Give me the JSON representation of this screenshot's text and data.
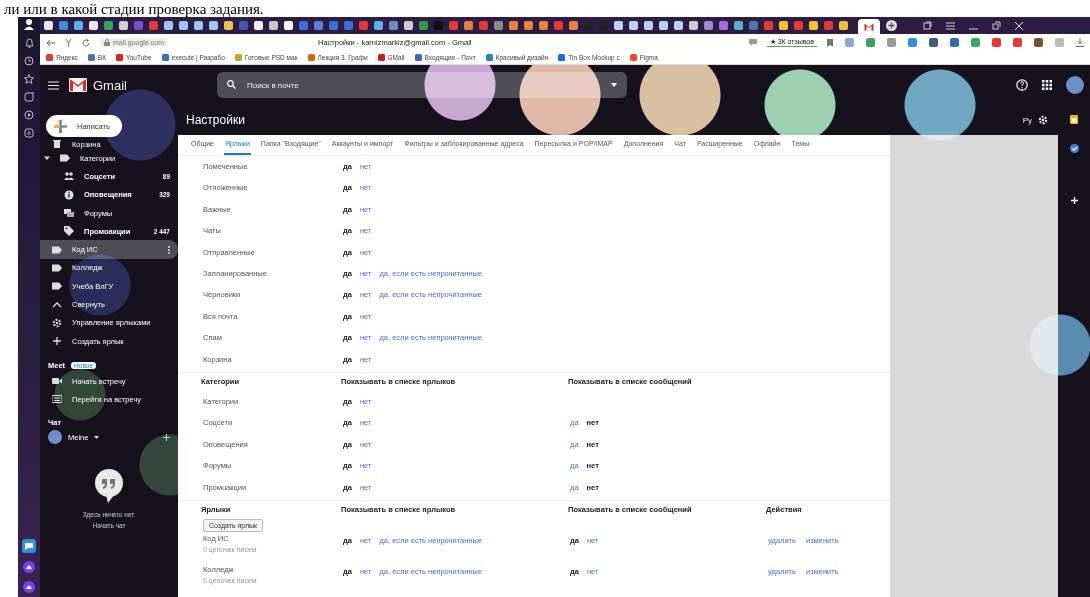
{
  "document_text": "ли или в какой стадии проверка задания.",
  "browser": {
    "address": "mail.google.com",
    "page_title": "Настройки - karnizmarkiz@gmail.com - Gmail",
    "reviews_badge": "★ 3К отзывов",
    "bookmarks": [
      {
        "label": "Яндекс",
        "color": "#e53935"
      },
      {
        "label": "ВК",
        "color": "#4a76a8"
      },
      {
        "label": "YouTube",
        "color": "#e62117"
      },
      {
        "label": "execute | Разрабо",
        "color": "#3d6fc4"
      },
      {
        "label": "Готовые PSD мак",
        "color": "#c9a227"
      },
      {
        "label": "Лекция 3. Графи",
        "color": "#d2691e"
      },
      {
        "label": "GMail",
        "color": "#c5221f"
      },
      {
        "label": "Входящие - Почт",
        "color": "#3367d6"
      },
      {
        "label": "Красивый дизайн",
        "color": "#2d7fd1"
      },
      {
        "label": "Tin Box Mockup c",
        "color": "#1769ff"
      },
      {
        "label": "Figma",
        "color": "#f24e1e"
      }
    ]
  },
  "gmail": {
    "logo": "Gmail",
    "search": {
      "placeholder": "Поиск в почте"
    },
    "language": "Ру",
    "compose": "Написать",
    "nav": [
      {
        "kind": "trash",
        "label": "Корзина",
        "unread": false,
        "selected": false
      },
      {
        "kind": "label",
        "label": "Категории",
        "unread": false,
        "selected": false,
        "expanded": true,
        "children": [
          {
            "kind": "people",
            "label": "Соцсети",
            "count": "89",
            "unread": true,
            "selected": false
          },
          {
            "kind": "info",
            "label": "Оповещения",
            "count": "329",
            "unread": true,
            "selected": false
          },
          {
            "kind": "forum",
            "label": "Форумы",
            "unread": false,
            "selected": false
          },
          {
            "kind": "tag",
            "label": "Промоакции",
            "count": "2 447",
            "unread": true,
            "selected": false
          }
        ]
      },
      {
        "kind": "label",
        "label": "Код ИС",
        "unread": false,
        "selected": true
      },
      {
        "kind": "label",
        "label": "Колледж",
        "unread": false,
        "selected": false
      },
      {
        "kind": "label",
        "label": "Учеба ВлГУ",
        "unread": false,
        "selected": false
      },
      {
        "kind": "collapse",
        "label": "Свернуть",
        "unread": false,
        "selected": false
      },
      {
        "kind": "gear",
        "label": "Управление ярлыками",
        "unread": false,
        "selected": false
      },
      {
        "kind": "plus",
        "label": "Создать ярлык",
        "unread": false,
        "selected": false
      }
    ],
    "meet": {
      "title": "Meet",
      "badge": "Новое",
      "items": [
        {
          "kind": "video",
          "label": "Начать встречу"
        },
        {
          "kind": "keyboard",
          "label": "Перейти на встречу"
        }
      ]
    },
    "chat": {
      "title": "Чат",
      "user": "Meine",
      "empty_text": "Здесь ничего нет.",
      "start_link": "Начать чат"
    },
    "settings": {
      "title": "Настройки",
      "tabs": [
        {
          "label": "Общие",
          "selected": false
        },
        {
          "label": "Ярлыки",
          "selected": true
        },
        {
          "label": "Папка \"Входящие\"",
          "selected": false
        },
        {
          "label": "Аккаунты и импорт",
          "selected": false
        },
        {
          "label": "Фильтры и заблокированные адреса",
          "selected": false
        },
        {
          "label": "Пересылка и POP/IMAP",
          "selected": false
        },
        {
          "label": "Дополнения",
          "selected": false
        },
        {
          "label": "Чат",
          "selected": false
        },
        {
          "label": "Расширенные",
          "selected": false
        },
        {
          "label": "Офлайн",
          "selected": false
        },
        {
          "label": "Темы",
          "selected": false
        }
      ],
      "system_labels": [
        {
          "name": "Помеченные",
          "options": [
            {
              "label": "да",
              "selected": true
            },
            {
              "label": "нет",
              "selected": false
            }
          ]
        },
        {
          "name": "Отложенные",
          "options": [
            {
              "label": "да",
              "selected": true
            },
            {
              "label": "нет",
              "selected": false
            }
          ]
        },
        {
          "name": "Важные",
          "options": [
            {
              "label": "да",
              "selected": true
            },
            {
              "label": "нет",
              "selected": false
            }
          ]
        },
        {
          "name": "Чаты",
          "options": [
            {
              "label": "да",
              "selected": true
            },
            {
              "label": "нет",
              "selected": false
            }
          ]
        },
        {
          "name": "Отправленные",
          "options": [
            {
              "label": "да",
              "selected": true
            },
            {
              "label": "нет",
              "selected": false
            }
          ]
        },
        {
          "name": "Запланированные",
          "options": [
            {
              "label": "да",
              "selected": true
            },
            {
              "label": "нет",
              "selected": false
            },
            {
              "label": "да, если есть непрочитанные",
              "selected": false
            }
          ]
        },
        {
          "name": "Черновики",
          "options": [
            {
              "label": "да",
              "selected": true
            },
            {
              "label": "нет",
              "selected": false
            },
            {
              "label": "да, если есть непрочитанные",
              "selected": false
            }
          ]
        },
        {
          "name": "Вся почта",
          "options": [
            {
              "label": "да",
              "selected": true
            },
            {
              "label": "нет",
              "selected": false
            }
          ]
        },
        {
          "name": "Спам",
          "options": [
            {
              "label": "да",
              "selected": true
            },
            {
              "label": "нет",
              "selected": false
            },
            {
              "label": "да, если есть непрочитанные",
              "selected": false
            }
          ]
        },
        {
          "name": "Корзина",
          "options": [
            {
              "label": "да",
              "selected": true
            },
            {
              "label": "нет",
              "selected": false
            }
          ]
        }
      ],
      "categories": {
        "columns": [
          "Категории",
          "Показывать в списке ярлыков",
          "Показывать в списке сообщений"
        ],
        "rows": [
          {
            "name": "Категории",
            "list_options": [
              {
                "label": "да",
                "selected": true
              },
              {
                "label": "нет",
                "selected": false
              }
            ],
            "message_options": []
          },
          {
            "name": "Соцсети",
            "list_options": [
              {
                "label": "да",
                "selected": true
              },
              {
                "label": "нет",
                "selected": false
              }
            ],
            "message_options": [
              {
                "label": "да",
                "selected": false
              },
              {
                "label": "нет",
                "selected": true
              }
            ]
          },
          {
            "name": "Оповещения",
            "list_options": [
              {
                "label": "да",
                "selected": true
              },
              {
                "label": "нет",
                "selected": false
              }
            ],
            "message_options": [
              {
                "label": "да",
                "selected": false
              },
              {
                "label": "нет",
                "selected": true
              }
            ]
          },
          {
            "name": "Форумы",
            "list_options": [
              {
                "label": "да",
                "selected": true
              },
              {
                "label": "нет",
                "selected": false
              }
            ],
            "message_options": [
              {
                "label": "да",
                "selected": false
              },
              {
                "label": "нет",
                "selected": true
              }
            ]
          },
          {
            "name": "Промоакции",
            "list_options": [
              {
                "label": "да",
                "selected": true
              },
              {
                "label": "нет",
                "selected": false
              }
            ],
            "message_options": [
              {
                "label": "да",
                "selected": false
              },
              {
                "label": "нет",
                "selected": true
              }
            ]
          }
        ]
      },
      "labels": {
        "columns": [
          "Ярлыки",
          "Показывать в списке ярлыков",
          "Показывать в списке сообщений",
          "Действия"
        ],
        "create_button": "Создать ярлык",
        "rows": [
          {
            "name": "Код ИС",
            "count": "0 цепочек писем",
            "list_options": [
              {
                "label": "да",
                "selected": true
              },
              {
                "label": "нет",
                "selected": false
              },
              {
                "label": "да, если есть непрочитанные",
                "selected": false
              }
            ],
            "message_options": [
              {
                "label": "да",
                "selected": true
              },
              {
                "label": "нет",
                "selected": false
              }
            ],
            "actions": [
              "удалить",
              "изменить"
            ]
          },
          {
            "name": "Колледж",
            "count": "0 цепочек писем",
            "list_options": [
              {
                "label": "да",
                "selected": true
              },
              {
                "label": "нет",
                "selected": false
              },
              {
                "label": "да, если есть непрочитанные",
                "selected": false
              }
            ],
            "message_options": [
              {
                "label": "да",
                "selected": true
              },
              {
                "label": "нет",
                "selected": false
              }
            ],
            "actions": [
              "удалить",
              "изменить"
            ]
          }
        ]
      }
    }
  }
}
